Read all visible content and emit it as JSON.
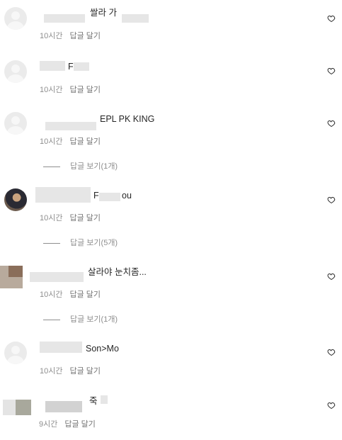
{
  "comments": [
    {
      "text": "쌀라 가",
      "time": "10시간",
      "reply": "답글 달기",
      "avatar": "default-avatar-icon",
      "liked": false
    },
    {
      "text": "F",
      "time": "10시간",
      "reply": "답글 달기",
      "avatar": "default-avatar-icon",
      "liked": false
    },
    {
      "text": "EPL PK KING",
      "time": "10시간",
      "reply": "답글 달기",
      "view_replies": "답글 보기(1개)",
      "avatar": "default-avatar-icon",
      "liked": false
    },
    {
      "text": "F",
      "text_suffix": "ou",
      "time": "10시간",
      "reply": "답글 달기",
      "view_replies": "답글 보기(5개)",
      "avatar": "profile-photo",
      "liked": false
    },
    {
      "text": "살라야 눈치좀...",
      "time": "10시간",
      "reply": "답글 달기",
      "view_replies": "답글 보기(1개)",
      "avatar": "blurred-profile-photo",
      "liked": false
    },
    {
      "text": "Son>Mo",
      "time": "10시간",
      "reply": "답글 달기",
      "avatar": "default-avatar-icon",
      "liked": false
    },
    {
      "text": "죽",
      "time": "9시간",
      "reply": "답글 달기",
      "avatar": "blurred-profile-photo",
      "liked": false
    }
  ],
  "colors": {
    "text": "#262626",
    "meta": "#8e8e8e",
    "avatar_bg": "#ebebeb",
    "heart_stroke": "#262626"
  }
}
